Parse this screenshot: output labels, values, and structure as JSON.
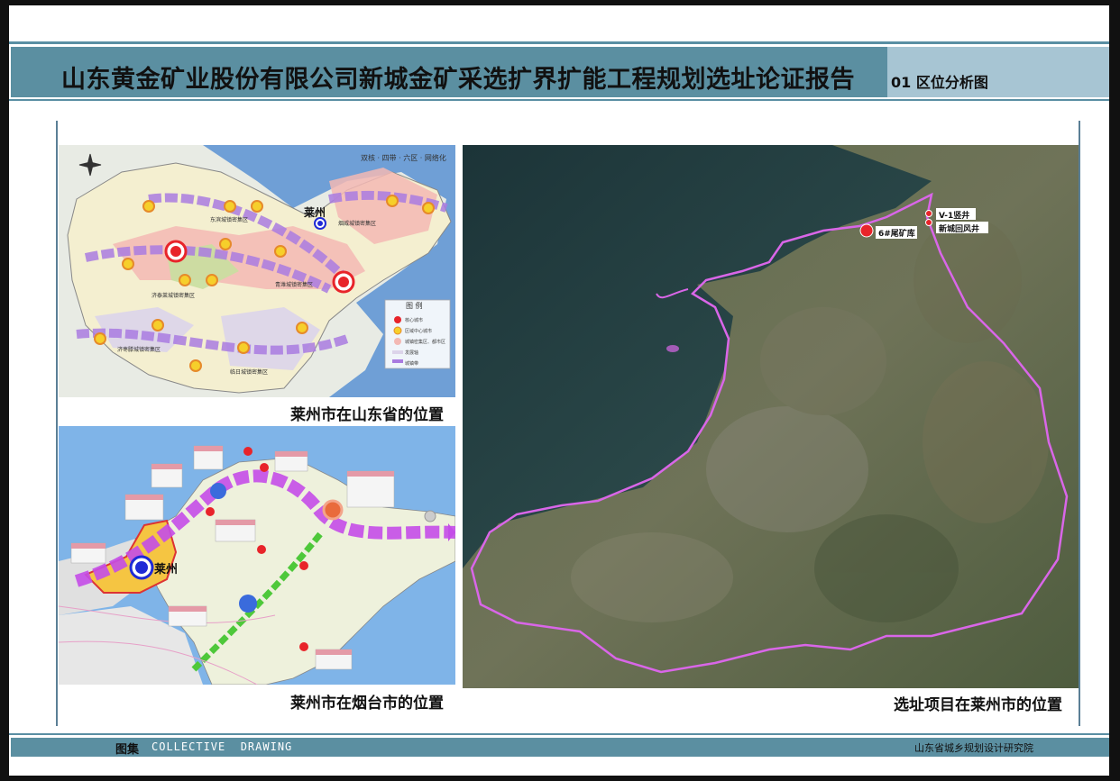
{
  "header": {
    "title": "山东黄金矿业股份有限公司新城金矿采选扩界扩能工程规划选址论证报告",
    "subtitle": "01 区位分析图"
  },
  "map1": {
    "caption": "莱州市在山东省的位置",
    "top_right_text": "双核 · 四带 · 六区 · 网络化",
    "city_label": "莱州",
    "legend_title": "图 例",
    "legend_items": [
      "核心城市",
      "区域中心城市",
      "城镇密集区、都市区",
      "发展轴",
      "城镇带"
    ],
    "region_labels": [
      "烟威城镇密集区",
      "东滨城镇密集区",
      "济泰莱城镇密集区",
      "青潍城镇密集区",
      "济枣滕城镇密集区",
      "临日城镇密集区"
    ]
  },
  "map2": {
    "caption": "莱州市在烟台市的位置",
    "city_label": "莱州"
  },
  "map3": {
    "caption": "选址项目在莱州市的位置",
    "markers": [
      {
        "label": "6#尾矿库"
      },
      {
        "label": "V-1竖井"
      },
      {
        "label": "新城回风井"
      }
    ]
  },
  "footer": {
    "label": "图集",
    "english": "COLLECTIVE  DRAWING",
    "org": "山东省城乡规划设计研究院"
  },
  "colors": {
    "header_bar": "#5b8fa1",
    "subtitle_bar": "#a7c5d3",
    "boundary": "#d966e8",
    "marker": "#e8242a"
  }
}
